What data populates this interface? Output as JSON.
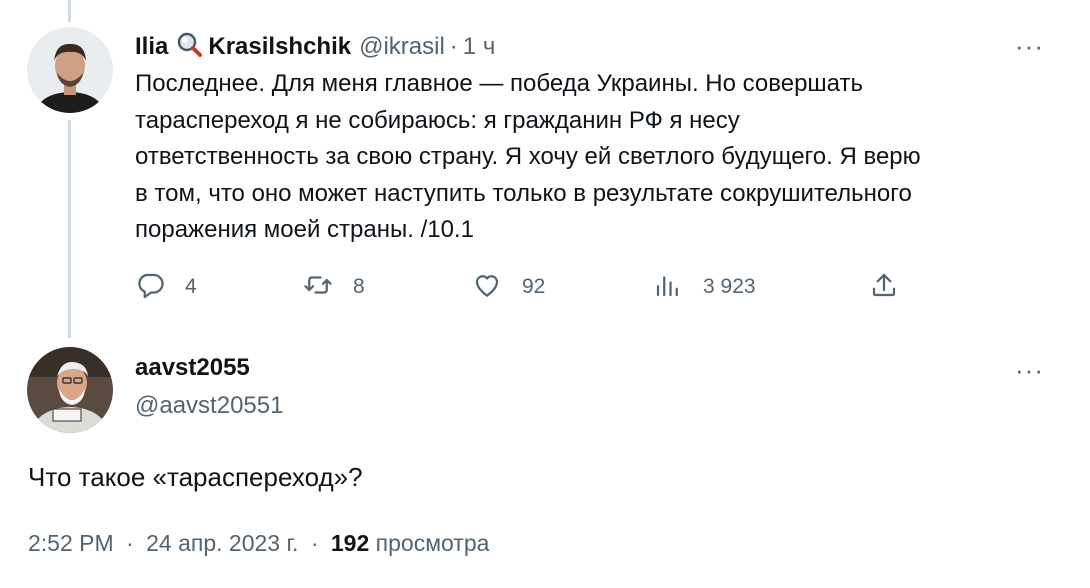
{
  "tweet": {
    "author_first": "Ilia",
    "author_emoji_icon": "magnifier-icon",
    "author_last": "Krasilshchik",
    "handle": "@ikrasil",
    "separator": "·",
    "time": "1 ч",
    "more_label": "···",
    "text": "Последнее. Для меня главное — победа Украины. Но совершать\nтараспереход я не собираюсь: я гражданин РФ я несу\nответственность за свою страну. Я хочу ей светлого будущего. Я верю\nв том, что оно может наступить только в результате сокрушительного\nпоражения моей страны. /10.1",
    "actions": {
      "replies": "4",
      "retweets": "8",
      "likes": "92",
      "views": "3 923"
    }
  },
  "reply": {
    "display_name": "aavst2055",
    "handle": "@aavst20551",
    "more_label": "···",
    "text": "Что такое «тараспереход»?",
    "time": "2:52 PM",
    "sep1": "·",
    "date": "24 апр. 2023 г.",
    "sep2": "·",
    "views_count": "192",
    "views_label": "просмотра"
  },
  "colors": {
    "text": "#0f1419",
    "secondary": "#536471",
    "thread_line": "#cfd9de"
  }
}
